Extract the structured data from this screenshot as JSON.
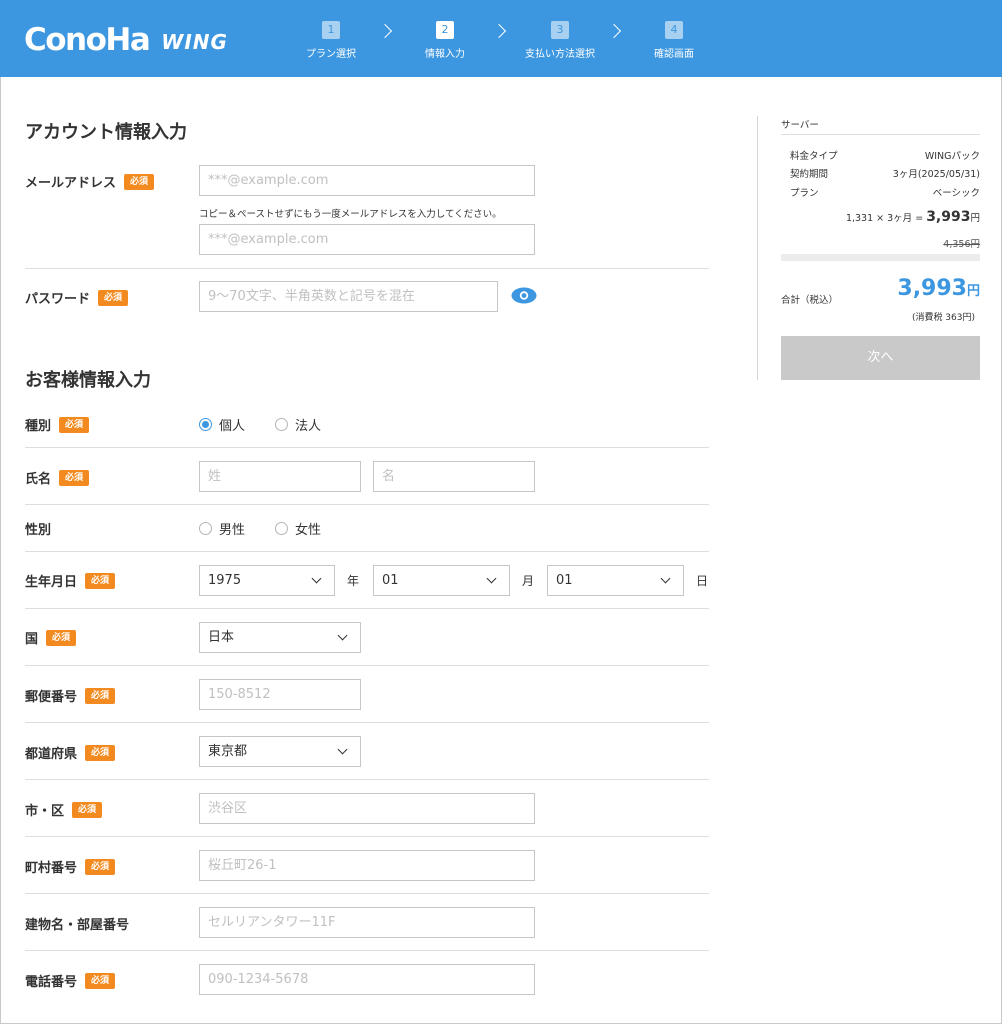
{
  "header": {
    "logo_main": "ConoHa",
    "logo_sub": "WING",
    "steps": [
      {
        "num": "1",
        "label": "プラン選択"
      },
      {
        "num": "2",
        "label": "情報入力"
      },
      {
        "num": "3",
        "label": "支払い方法選択"
      },
      {
        "num": "4",
        "label": "確認画面"
      }
    ],
    "active_step": 2
  },
  "account": {
    "title": "アカウント情報入力",
    "email_label": "メールアドレス",
    "required": "必須",
    "email_placeholder": "***@example.com",
    "email_hint": "コピー＆ペーストせずにもう一度メールアドレスを入力してください。",
    "email_confirm_placeholder": "***@example.com",
    "password_label": "パスワード",
    "password_placeholder": "9〜70文字、半角英数と記号を混在"
  },
  "customer": {
    "title": "お客様情報入力",
    "type_label": "種別",
    "type_options": [
      "個人",
      "法人"
    ],
    "type_selected": "個人",
    "name_label": "氏名",
    "last_name_placeholder": "姓",
    "first_name_placeholder": "名",
    "gender_label": "性別",
    "gender_options": [
      "男性",
      "女性"
    ],
    "birth_label": "生年月日",
    "birth_year": "1975",
    "year_unit": "年",
    "birth_month": "01",
    "month_unit": "月",
    "birth_day": "01",
    "day_unit": "日",
    "country_label": "国",
    "country_value": "日本",
    "postal_label": "郵便番号",
    "postal_placeholder": "150-8512",
    "prefecture_label": "都道府県",
    "prefecture_value": "東京都",
    "city_label": "市・区",
    "city_placeholder": "渋谷区",
    "town_label": "町村番号",
    "town_placeholder": "桜丘町26-1",
    "building_label": "建物名・部屋番号",
    "building_placeholder": "セルリアンタワー11F",
    "phone_label": "電話番号",
    "phone_placeholder": "090-1234-5678"
  },
  "sidebar": {
    "title": "サーバー",
    "rows": [
      {
        "key": "料金タイプ",
        "value": "WINGパック"
      },
      {
        "key": "契約期間",
        "value": "3ヶ月(2025/05/31)"
      },
      {
        "key": "プラン",
        "value": "ベーシック"
      }
    ],
    "calc_prefix": "1,331 × 3ヶ月 = ",
    "calc_amount": "3,993",
    "calc_unit": "円",
    "original_price": "4,356円",
    "total_label": "合計（税込）",
    "total_amount": "3,993",
    "total_unit": "円",
    "tax_note": "(消費税 363円)",
    "next_button": "次へ"
  },
  "colors": {
    "brand": "#3d97e0",
    "required_badge": "#f28a1f",
    "disabled_button": "#c9c9c9"
  }
}
